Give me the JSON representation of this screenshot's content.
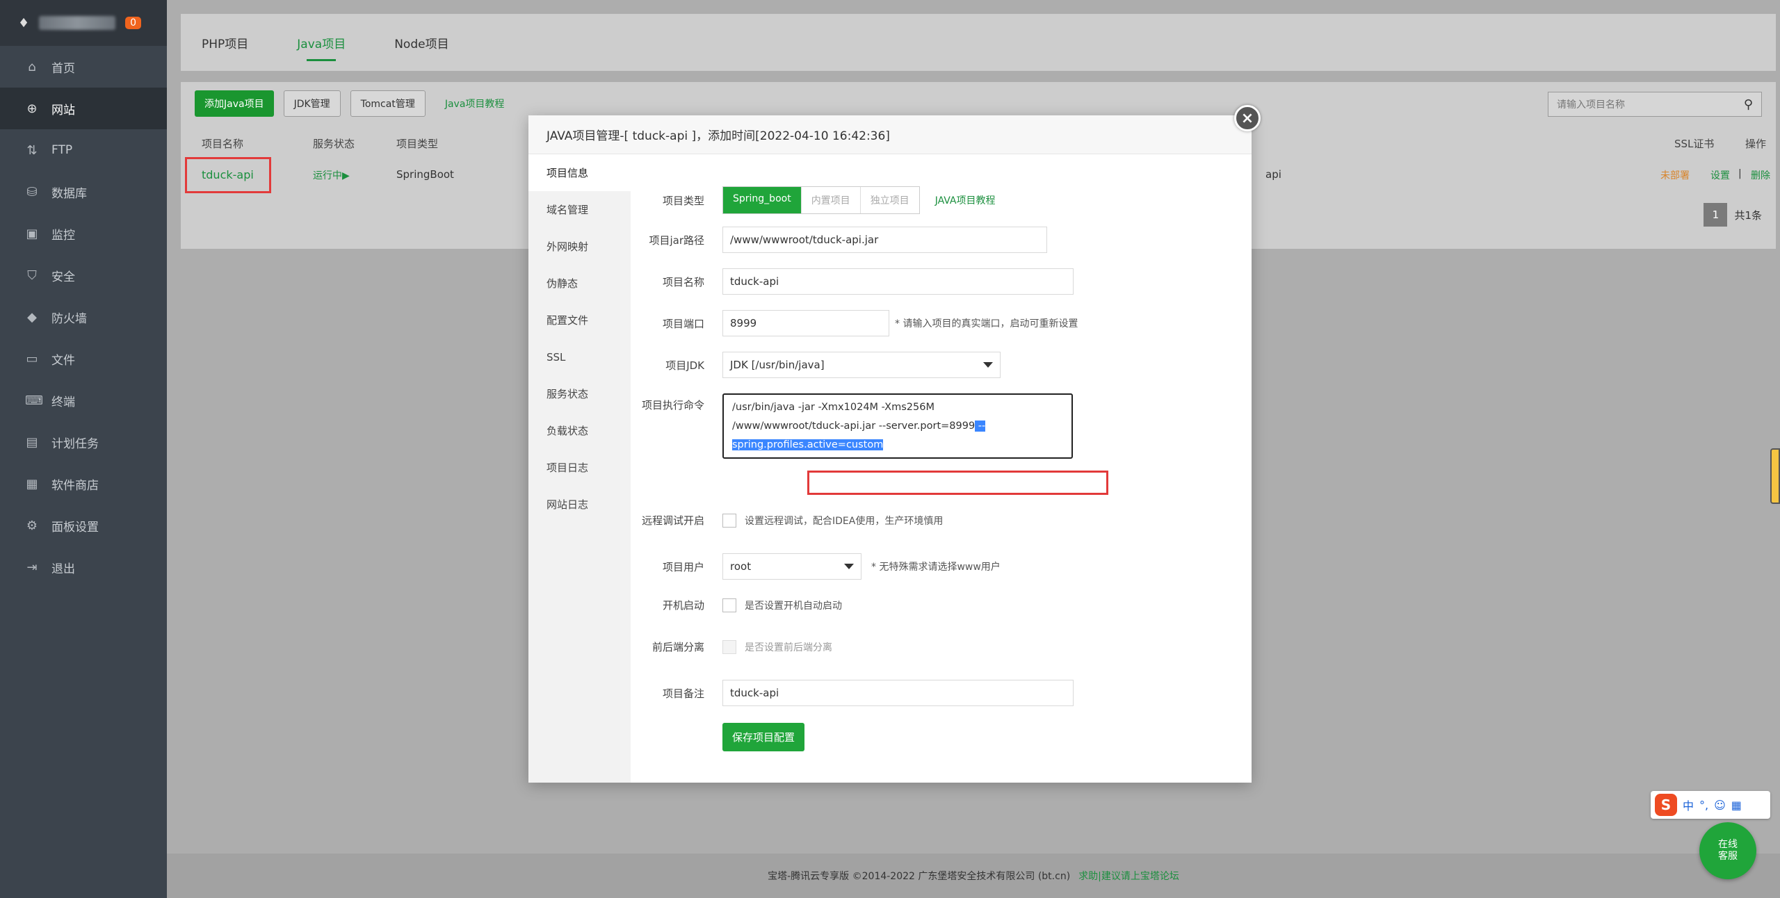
{
  "sidebar": {
    "badge": "0",
    "items": [
      {
        "label": "首页",
        "icon": "home-icon"
      },
      {
        "label": "网站",
        "icon": "globe-icon"
      },
      {
        "label": "FTP",
        "icon": "ftp-icon"
      },
      {
        "label": "数据库",
        "icon": "database-icon"
      },
      {
        "label": "监控",
        "icon": "monitor-icon"
      },
      {
        "label": "安全",
        "icon": "shield-icon"
      },
      {
        "label": "防火墙",
        "icon": "firewall-icon"
      },
      {
        "label": "文件",
        "icon": "folder-icon"
      },
      {
        "label": "终端",
        "icon": "terminal-icon"
      },
      {
        "label": "计划任务",
        "icon": "calendar-icon"
      },
      {
        "label": "软件商店",
        "icon": "apps-icon"
      },
      {
        "label": "面板设置",
        "icon": "settings-icon"
      },
      {
        "label": "退出",
        "icon": "logout-icon"
      }
    ]
  },
  "tabs": [
    "PHP项目",
    "Java项目",
    "Node项目"
  ],
  "toolbar": {
    "add": "添加Java项目",
    "jdk": "JDK管理",
    "tomcat": "Tomcat管理",
    "tutorial": "Java项目教程",
    "search_placeholder": "请输入项目名称"
  },
  "table": {
    "headers": {
      "name": "项目名称",
      "status": "服务状态",
      "type": "项目类型",
      "ssl": "SSL证书",
      "ops": "操作"
    },
    "row": {
      "name": "tduck-api",
      "status": "运行中▶",
      "type": "SpringBoot",
      "domain": "api",
      "ssl": "未部署",
      "settings": "设置",
      "sep": "|",
      "delete": "删除"
    },
    "pager": {
      "page": "1",
      "total": "共1条"
    }
  },
  "modal": {
    "title": "JAVA项目管理-[ tduck-api ]，添加时间[2022-04-10 16:42:36]",
    "nav": [
      "项目信息",
      "域名管理",
      "外网映射",
      "伪静态",
      "配置文件",
      "SSL",
      "服务状态",
      "负载状态",
      "项目日志",
      "网站日志"
    ],
    "form": {
      "type_label": "项目类型",
      "type_options": [
        "Spring_boot",
        "内置项目",
        "独立项目"
      ],
      "type_tutorial": "JAVA项目教程",
      "jar_label": "项目jar路径",
      "jar_value": "/www/wwwroot/tduck-api.jar",
      "name_label": "项目名称",
      "name_value": "tduck-api",
      "port_label": "项目端口",
      "port_value": "8999",
      "port_note": "* 请输入项目的真实端口，启动可重新设置",
      "jdk_label": "项目JDK",
      "jdk_value": "JDK [/usr/bin/java]",
      "cmd_label": "项目执行命令",
      "cmd_line1": "/usr/bin/java -jar -Xmx1024M -Xms256M",
      "cmd_line2": "/www/wwwroot/tduck-api.jar --server.port=8999",
      "cmd_line2_sel": " --",
      "cmd_line3": "spring.profiles.active=custom",
      "debug_label": "远程调试开启",
      "debug_note": "设置远程调试，配合IDEA使用，生产环境慎用",
      "user_label": "项目用户",
      "user_value": "root",
      "user_note": "* 无特殊需求请选择www用户",
      "boot_label": "开机启动",
      "boot_note": "是否设置开机自动启动",
      "sep_label": "前后端分离",
      "sep_note": "是否设置前后端分离",
      "remark_label": "项目备注",
      "remark_value": "tduck-api",
      "save": "保存项目配置"
    }
  },
  "footer": {
    "text": "宝塔-腾讯云专享版 ©2014-2022 广东堡塔安全技术有限公司 (bt.cn)",
    "link": "求助|建议请上宝塔论坛"
  },
  "ime": {
    "s": "S",
    "zh": "中",
    "punct": "°,"
  },
  "chat": {
    "line1": "在线",
    "line2": "客服"
  }
}
